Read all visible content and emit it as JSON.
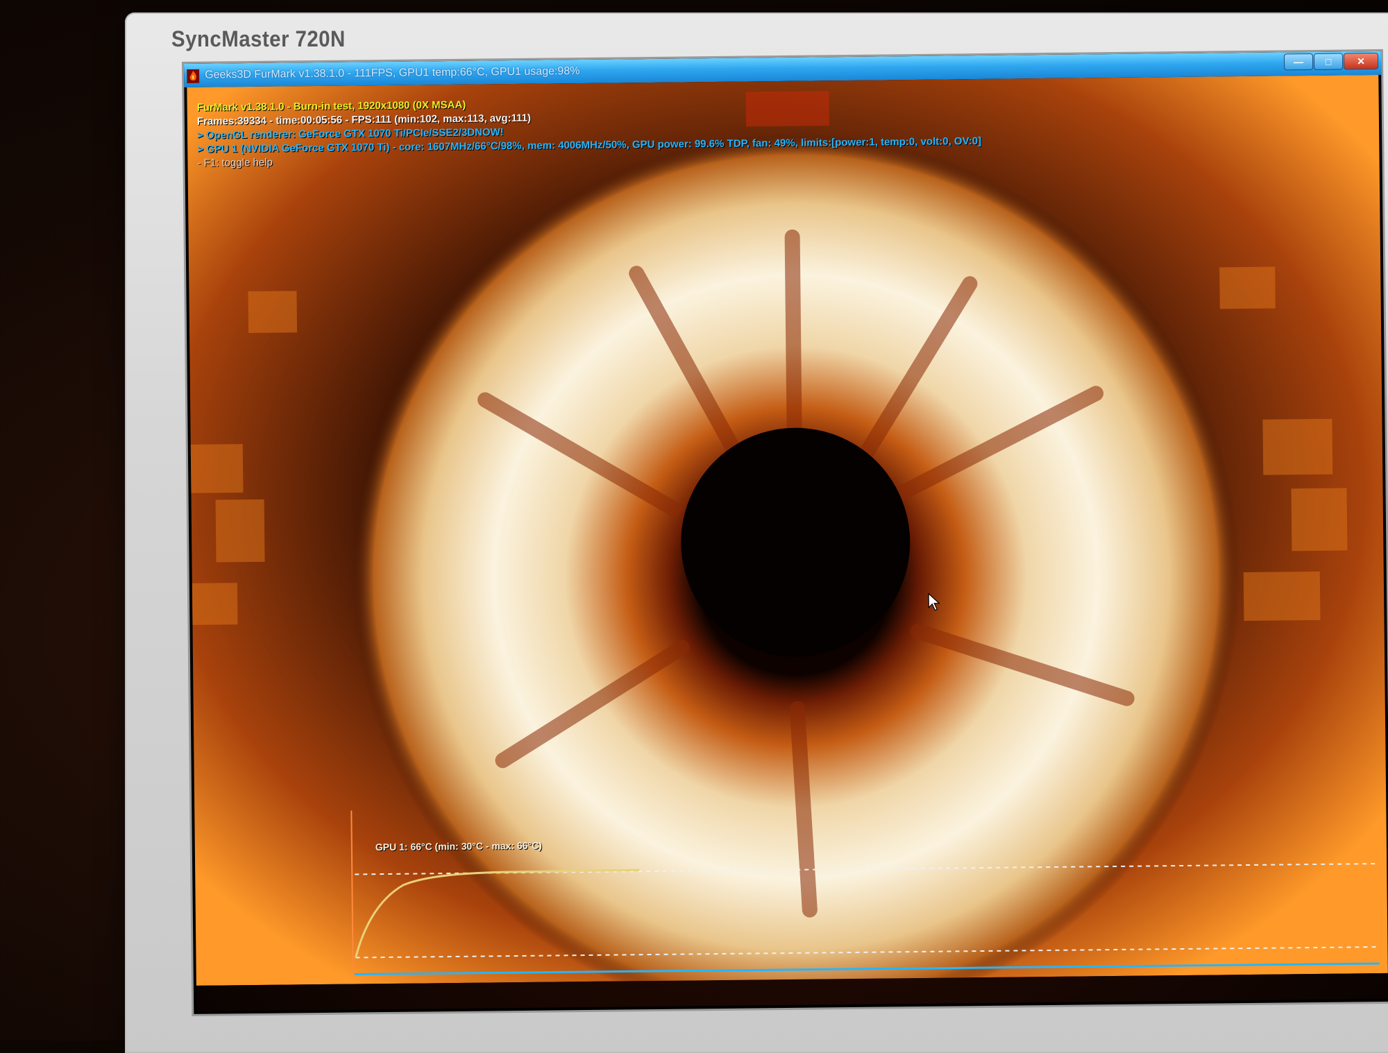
{
  "monitor": {
    "brand": "SyncMaster 720N"
  },
  "window": {
    "title": "Geeks3D FurMark v1.38.1.0 - 111FPS, GPU1 temp:66°C, GPU1 usage:98%",
    "buttons": {
      "minimize": "—",
      "maximize": "□",
      "close": "✕"
    }
  },
  "hud": {
    "line1": "FurMark v1.38.1.0 - Burn-in test, 1920x1080 (0X MSAA)",
    "line2": "Frames:39334 - time:00:05:56 - FPS:111 (min:102, max:113, avg:111)",
    "line3": "> OpenGL renderer: GeForce GTX 1070 Ti/PCIe/SSE2/3DNOW!",
    "line4": "> GPU 1 (NVIDIA GeForce GTX 1070 Ti) - core: 1607MHz/66°C/98%, mem: 4006MHz/50%, GPU power: 99.6% TDP, fan: 49%, limits:[power:1, temp:0, volt:0, OV:0]",
    "line5": "- F1: toggle help",
    "colors": {
      "title": "#e8ef2a",
      "stats": "#f2f2f2",
      "info": "#24b6ff"
    }
  },
  "temperature_graph": {
    "label": "GPU 1: 66°C (min: 30°C - max: 66°C)",
    "line_color": "#e8d27a",
    "baseline_color": "#24b6ff"
  },
  "icons": {
    "app": "furmark-flame-icon",
    "cursor": "mouse-pointer-icon"
  }
}
